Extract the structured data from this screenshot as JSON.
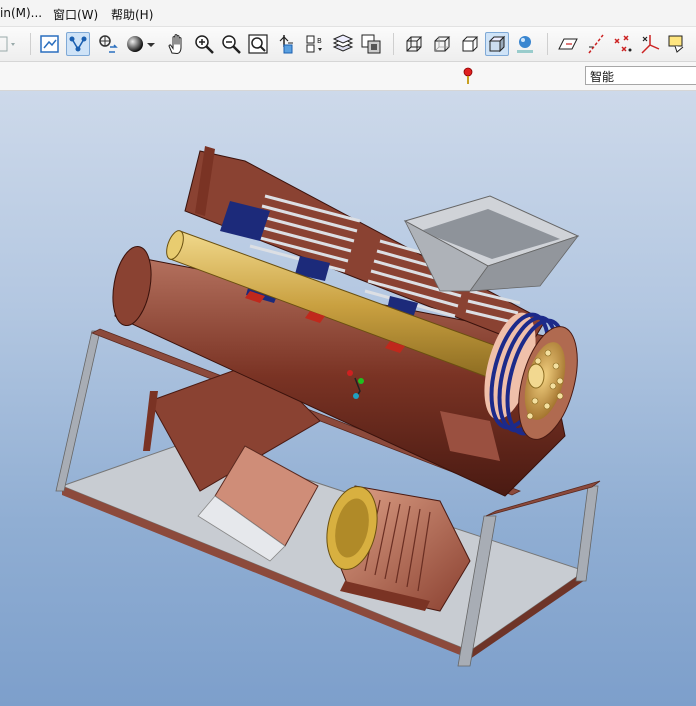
{
  "menu": {
    "items": [
      "in(M)...",
      "窗口(W)",
      "帮助(H)"
    ]
  },
  "toolbar": {
    "buttons": [
      "dropdown-arrow-icon",
      "repaint-icon",
      "spin-center-icon",
      "orient-icon",
      "shading-sphere-icon",
      "pan-hand-icon",
      "zoom-in-icon",
      "zoom-out-icon",
      "zoom-fit-icon",
      "view-manager-icon",
      "named-view-icon",
      "layers-icon",
      "display-style-icon",
      "wireframe-icon",
      "hidden-line-icon",
      "no-hidden-icon",
      "shaded-icon",
      "model-tree-icon",
      "datum-plane-icon",
      "datum-axis-icon",
      "datum-point-icon",
      "csys-icon",
      "annotation-icon"
    ]
  },
  "toolbar2": {
    "filter_value": "智能",
    "status_indicator": "red-light-icon"
  },
  "viewport": {
    "model": "3D CAD model"
  }
}
